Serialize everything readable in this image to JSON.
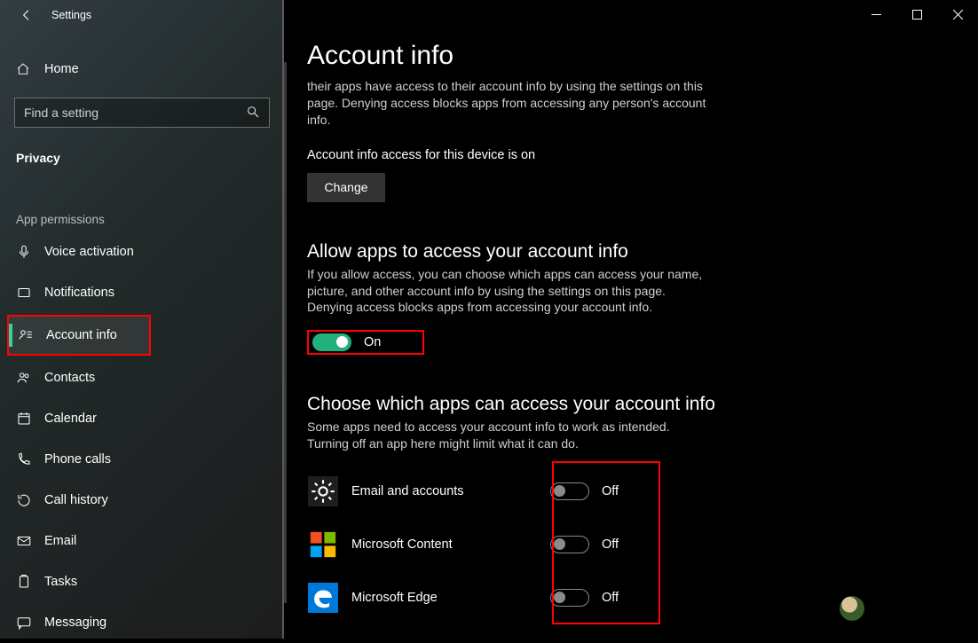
{
  "window": {
    "title": "Settings"
  },
  "sidebar": {
    "home_label": "Home",
    "search_placeholder": "Find a setting",
    "category": "Privacy",
    "group_label": "App permissions",
    "items": [
      {
        "label": "Voice activation"
      },
      {
        "label": "Notifications"
      },
      {
        "label": "Account info"
      },
      {
        "label": "Contacts"
      },
      {
        "label": "Calendar"
      },
      {
        "label": "Phone calls"
      },
      {
        "label": "Call history"
      },
      {
        "label": "Email"
      },
      {
        "label": "Tasks"
      },
      {
        "label": "Messaging"
      }
    ]
  },
  "main": {
    "title": "Account info",
    "intro_tail": "their apps have access to their account info by using the settings on this page. Denying access blocks apps from accessing any person's account info.",
    "device_status": "Account info access for this device is on",
    "change_label": "Change",
    "allow_title": "Allow apps to access your account info",
    "allow_desc": "If you allow access, you can choose which apps can access your name, picture, and other account info by using the settings on this page. Denying access blocks apps from accessing your account info.",
    "allow_toggle_label": "On",
    "choose_title": "Choose which apps can access your account info",
    "choose_desc": "Some apps need to access your account info to work as intended. Turning off an app here might limit what it can do.",
    "apps": [
      {
        "name": "Email and accounts",
        "state": "Off"
      },
      {
        "name": "Microsoft Content",
        "state": "Off"
      },
      {
        "name": "Microsoft Edge",
        "state": "Off"
      }
    ]
  }
}
